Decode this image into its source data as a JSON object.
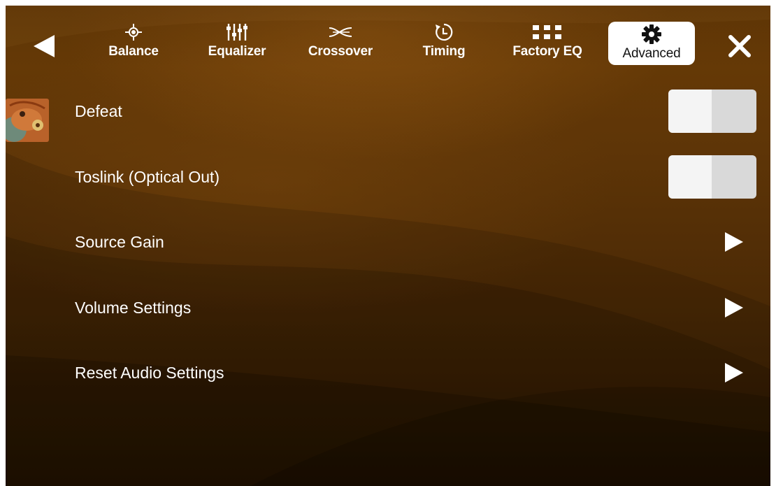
{
  "nav": {
    "back_icon": "back-triangle-icon",
    "close_icon": "close-x-icon",
    "tabs": [
      {
        "label": "Balance",
        "icon": "crosshair-target-icon"
      },
      {
        "label": "Equalizer",
        "icon": "sliders-icon"
      },
      {
        "label": "Crossover",
        "icon": "crossover-curves-icon"
      },
      {
        "label": "Timing",
        "icon": "clock-timer-icon"
      },
      {
        "label": "Factory EQ",
        "icon": "grid-dots-icon"
      },
      {
        "label": "Advanced",
        "icon": "gear-icon",
        "active": true
      }
    ]
  },
  "settings": {
    "rows": [
      {
        "label": "Defeat",
        "control": "toggle",
        "on": false
      },
      {
        "label": "Toslink (Optical Out)",
        "control": "toggle",
        "on": false
      },
      {
        "label": "Source Gain",
        "control": "arrow"
      },
      {
        "label": "Volume Settings",
        "control": "arrow"
      },
      {
        "label": "Reset Audio Settings",
        "control": "arrow"
      }
    ]
  },
  "colors": {
    "background": "#5e3507",
    "text": "#ffffff",
    "active_tab": "#ffffff",
    "toggle_track": "#d9d9d9",
    "toggle_knob": "#f4f4f4"
  }
}
